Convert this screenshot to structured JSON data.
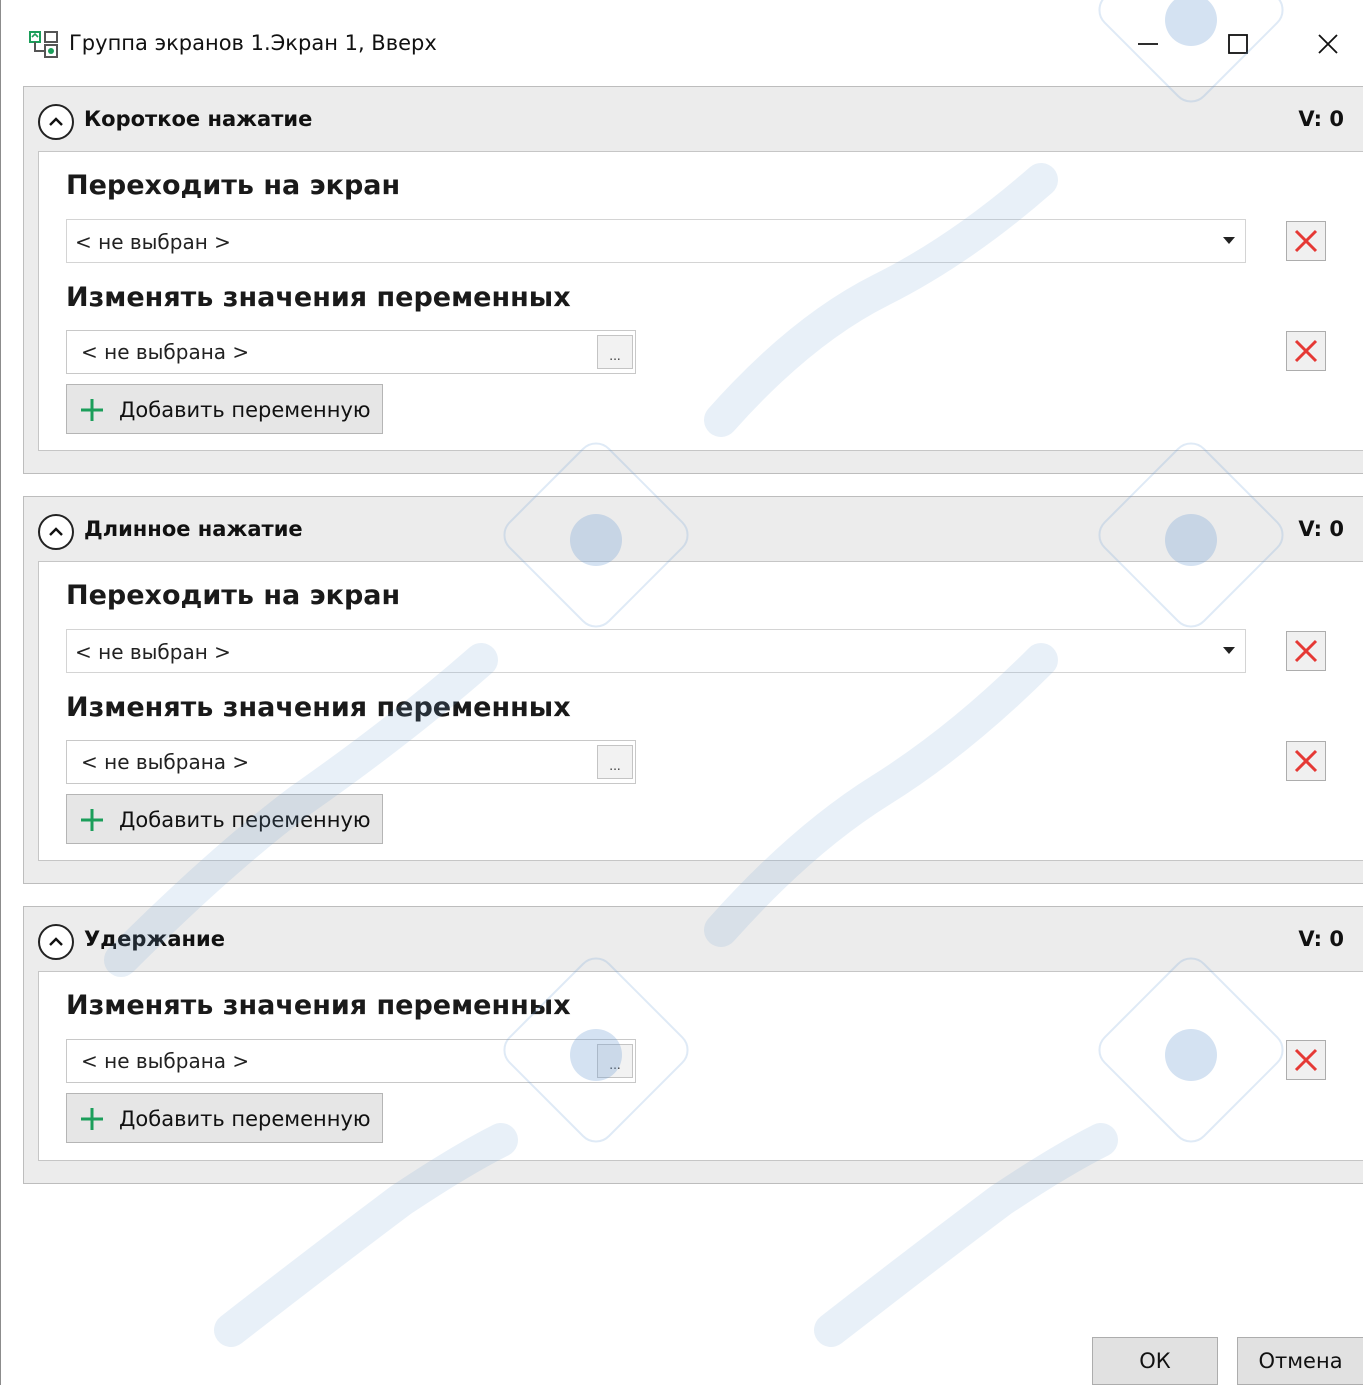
{
  "window": {
    "title": "Группа экранов 1.Экран 1, Вверх"
  },
  "sections": [
    {
      "title": "Короткое нажатие",
      "value": "V: 0",
      "goto_label": "Переходить на экран",
      "goto_value": "< не выбран >",
      "vars_label": "Изменять значения переменных",
      "var_value": "< не выбрана >",
      "ellipsis": "...",
      "add_label": "Добавить переменную"
    },
    {
      "title": "Длинное нажатие",
      "value": "V: 0",
      "goto_label": "Переходить на экран",
      "goto_value": "< не выбран >",
      "vars_label": "Изменять значения переменных",
      "var_value": "< не выбрана >",
      "ellipsis": "...",
      "add_label": "Добавить переменную"
    },
    {
      "title": "Удержание",
      "value": "V: 0",
      "vars_label": "Изменять значения переменных",
      "var_value": "< не выбрана >",
      "ellipsis": "...",
      "add_label": "Добавить переменную"
    }
  ],
  "footer": {
    "ok_label": "ОК",
    "cancel_label": "Отмена"
  },
  "colors": {
    "delete_x": "#e53935",
    "add_plus": "#1b9e5a",
    "icon_green": "#1b9e5a",
    "section_bg": "#ececec"
  },
  "icons": {
    "app": "screen-group-icon",
    "collapse": "chevron-up-icon",
    "delete": "close-x-icon",
    "add": "plus-icon",
    "dropdown": "caret-down-icon"
  }
}
